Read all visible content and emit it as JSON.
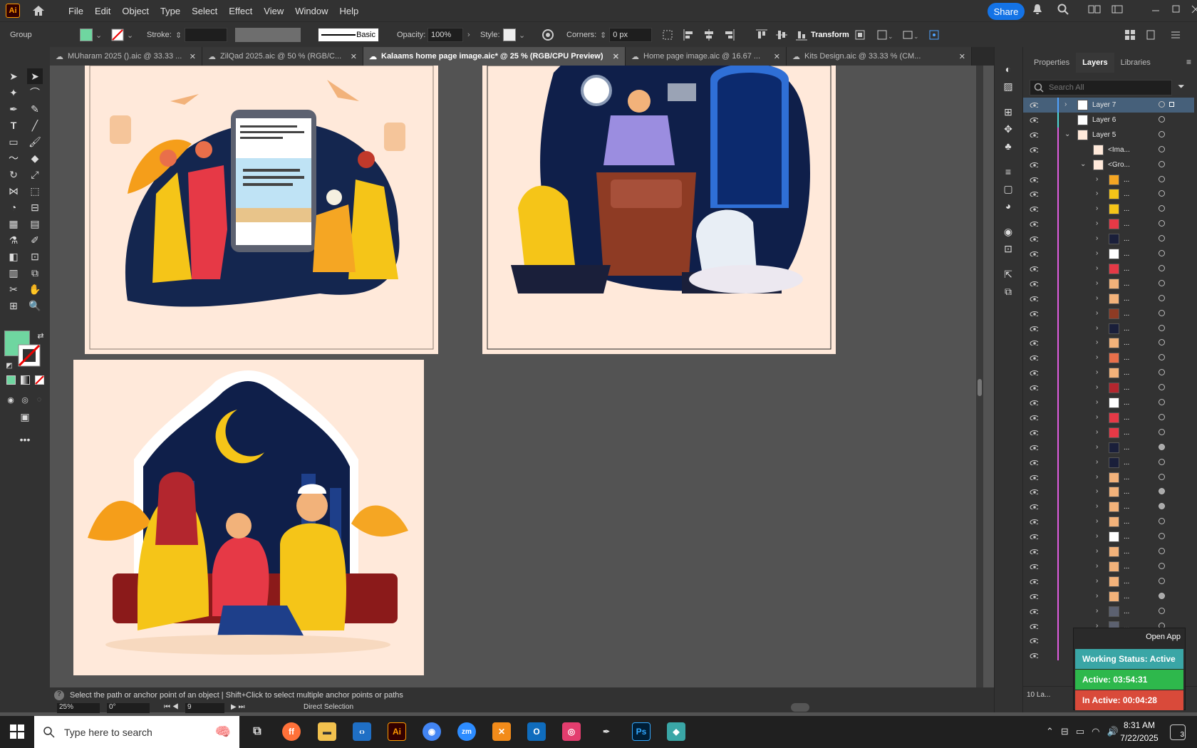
{
  "app": {
    "logo_text": "Ai",
    "share_label": "Share"
  },
  "menu": [
    "File",
    "Edit",
    "Object",
    "Type",
    "Select",
    "Effect",
    "View",
    "Window",
    "Help"
  ],
  "control": {
    "selection": "Group",
    "fill_color": "#6fd6a0",
    "stroke_label": "Stroke:",
    "brush_label": "Basic",
    "opacity_label": "Opacity:",
    "opacity_value": "100%",
    "style_label": "Style:",
    "corners_label": "Corners:",
    "corners_value": "0 px",
    "transform_label": "Transform"
  },
  "tabs": [
    {
      "label": "MUharam 2025 ().aic @ 33.33 ...",
      "active": false
    },
    {
      "label": "ZilQad 2025.aic @ 50 % (RGB/C...",
      "active": false
    },
    {
      "label": "Kalaams home page image.aic* @ 25 % (RGB/CPU Preview)",
      "active": true
    },
    {
      "label": "Home page image.aic @ 16.67 ...",
      "active": false
    },
    {
      "label": "Kits Design.aic @ 33.33 % (CM...",
      "active": false
    }
  ],
  "panel": {
    "tabs": [
      "Properties",
      "Layers",
      "Libraries"
    ],
    "active_tab": "Layers",
    "search_placeholder": "Search All",
    "layers": [
      {
        "name": "Layer 7",
        "indent": 0,
        "color": "#4fa3ff",
        "expand": "right",
        "selected": true
      },
      {
        "name": "Layer 6",
        "indent": 0,
        "color": "#4fd6d6",
        "expand": "none",
        "selected": false
      },
      {
        "name": "Layer 5",
        "indent": 0,
        "color": "#e05ce0",
        "expand": "down",
        "selected": false
      },
      {
        "name": "<Ima...",
        "indent": 1,
        "color": "#e05ce0",
        "expand": "none",
        "selected": false
      },
      {
        "name": "<Gro...",
        "indent": 1,
        "color": "#e05ce0",
        "expand": "down",
        "selected": false
      }
    ],
    "sublayer_label": "...",
    "footer_count": "10 La..."
  },
  "status": {
    "hint": "Select the path or anchor point of an object  |  Shift+Click to select multiple anchor points or paths",
    "zoom": "25%",
    "rotation": "0°",
    "artboard_num": "9",
    "tool_name": "Direct Selection"
  },
  "work_status": {
    "open_app": "Open App",
    "working": "Working Status: Active",
    "active": "Active: 03:54:31",
    "inactive": "In Active: 00:04:28"
  },
  "taskbar": {
    "search_placeholder": "Type here to search",
    "time": "8:31 AM",
    "date": "7/22/2025",
    "notification_count": "3"
  }
}
